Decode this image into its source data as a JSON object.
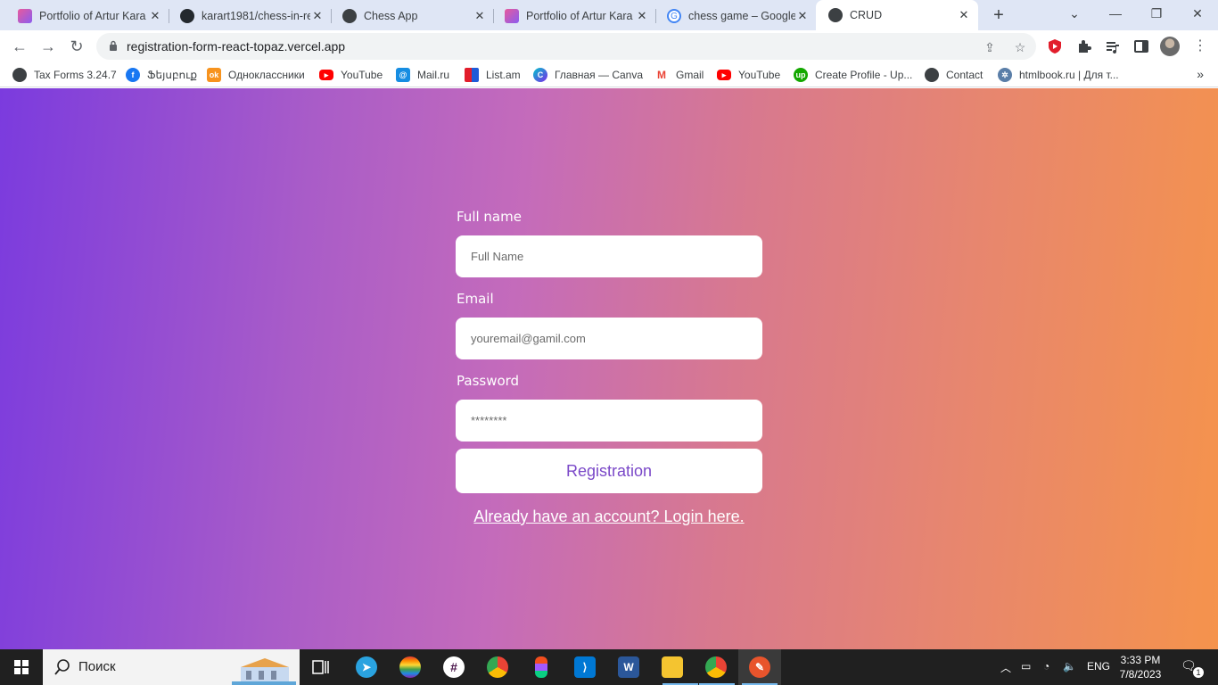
{
  "browser": {
    "tabs": [
      {
        "title": "Portfolio of Artur Kara",
        "icon": "portfolio-icon"
      },
      {
        "title": "karart1981/chess-in-re",
        "icon": "github-icon"
      },
      {
        "title": "Chess App",
        "icon": "globe-icon"
      },
      {
        "title": "Portfolio of Artur Kara",
        "icon": "portfolio-icon"
      },
      {
        "title": "chess game – Google",
        "icon": "google-icon"
      },
      {
        "title": "CRUD",
        "icon": "globe-icon",
        "active": true
      }
    ],
    "url": "registration-form-react-topaz.vercel.app",
    "bookmarks": [
      {
        "label": "Tax Forms 3.24.7",
        "icon": "globe-icon"
      },
      {
        "label": "Ֆեյսբուք",
        "icon": "facebook-icon"
      },
      {
        "label": "Одноклассники",
        "icon": "odnoklassniki-icon"
      },
      {
        "label": "YouTube",
        "icon": "youtube-icon"
      },
      {
        "label": "Mail.ru",
        "icon": "mailru-icon"
      },
      {
        "label": "List.am",
        "icon": "listam-icon"
      },
      {
        "label": "Главная — Canva",
        "icon": "canva-icon"
      },
      {
        "label": "Gmail",
        "icon": "gmail-icon"
      },
      {
        "label": "YouTube",
        "icon": "youtube-icon"
      },
      {
        "label": "Create Profile - Up...",
        "icon": "upwork-icon"
      },
      {
        "label": "Contact",
        "icon": "globe-icon"
      },
      {
        "label": "htmlbook.ru | Для т...",
        "icon": "htmlbook-icon"
      }
    ],
    "more_bookmarks": "»"
  },
  "form": {
    "fullname_label": "Full name",
    "fullname_placeholder": "Full Name",
    "email_label": "Email",
    "email_placeholder": "youremail@gamil.com",
    "password_label": "Password",
    "password_placeholder": "********",
    "submit_label": "Registration",
    "login_link": "Already have an account? Login here."
  },
  "taskbar": {
    "search_placeholder": "Поиск",
    "language": "ENG",
    "time": "3:33 PM",
    "date": "7/8/2023",
    "notification_count": "1"
  },
  "colors": {
    "gradient_start": "#7b3bde",
    "gradient_end": "#f5934c",
    "button_text": "#7a48c8"
  }
}
